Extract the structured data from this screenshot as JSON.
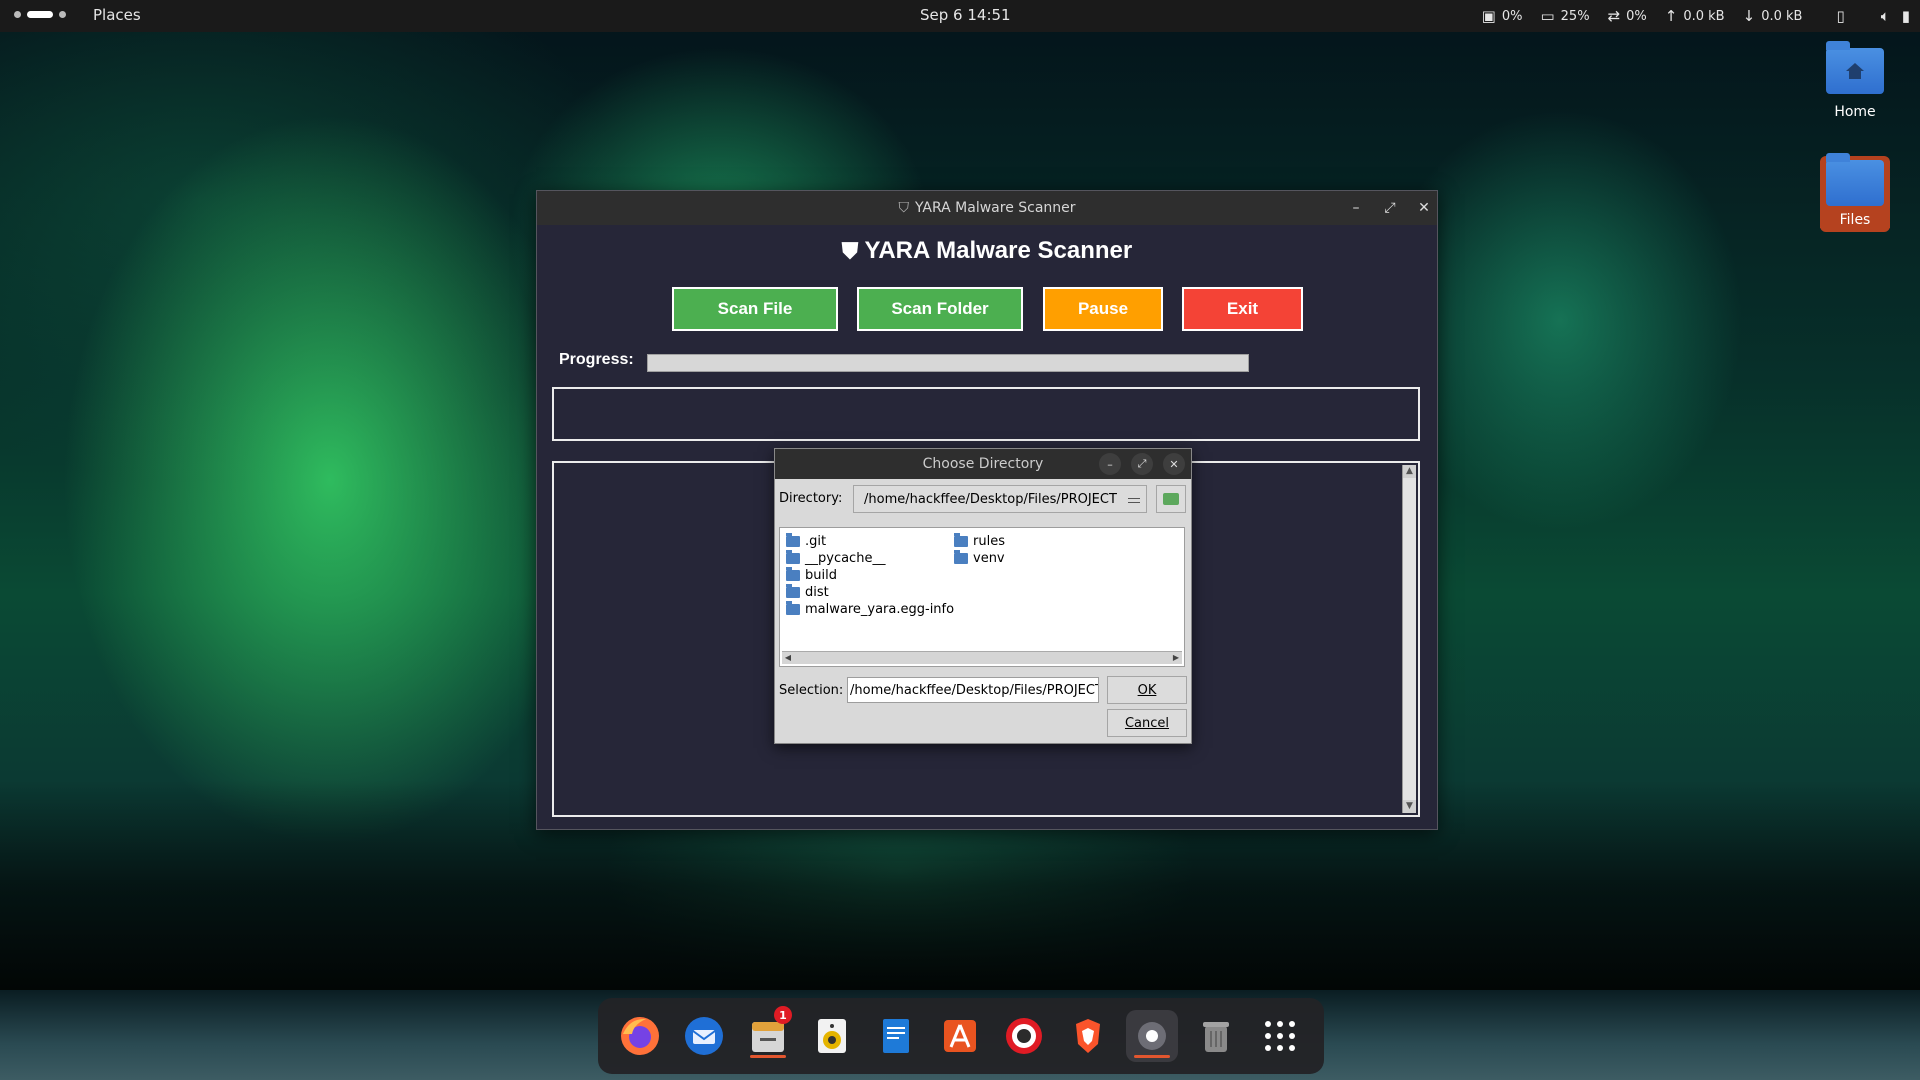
{
  "topbar": {
    "places": "Places",
    "clock": "Sep 6  14:51",
    "cpu": "0%",
    "memory": "25%",
    "swap": "0%",
    "upload": "0.0 kB",
    "download": "0.0 kB"
  },
  "desktop": {
    "icons": [
      {
        "label": "Home"
      },
      {
        "label": "Files"
      }
    ]
  },
  "window": {
    "title": "YARA Malware Scanner",
    "app_title": "YARA Malware Scanner",
    "buttons": {
      "scan_file": "Scan File",
      "scan_folder": "Scan Folder",
      "pause": "Pause",
      "exit": "Exit"
    },
    "progress_label": "Progress:",
    "progress_value": 0,
    "colors": {
      "scan": "#4caf50",
      "pause": "#ff9f00",
      "exit": "#f44336",
      "background": "#262638"
    }
  },
  "dialog": {
    "title": "Choose Directory",
    "directory_label": "Directory:",
    "directory_value": "/home/hackffee/Desktop/Files/PROJECT",
    "folders_col1": [
      ".git",
      "__pycache__",
      "build",
      "dist",
      "malware_yara.egg-info"
    ],
    "folders_col2": [
      "rules",
      "venv"
    ],
    "selection_label": "Selection:",
    "selection_value": "/home/hackffee/Desktop/Files/PROJECT",
    "ok": "OK",
    "cancel": "Cancel"
  },
  "dock": {
    "items": [
      "firefox-icon",
      "thunderbird-icon",
      "files-icon",
      "rhythmbox-icon",
      "writer-icon",
      "app-center-icon",
      "help-icon",
      "brave-icon",
      "settings-icon",
      "trash-icon",
      "app-grid-icon"
    ],
    "files_badge": "1"
  }
}
